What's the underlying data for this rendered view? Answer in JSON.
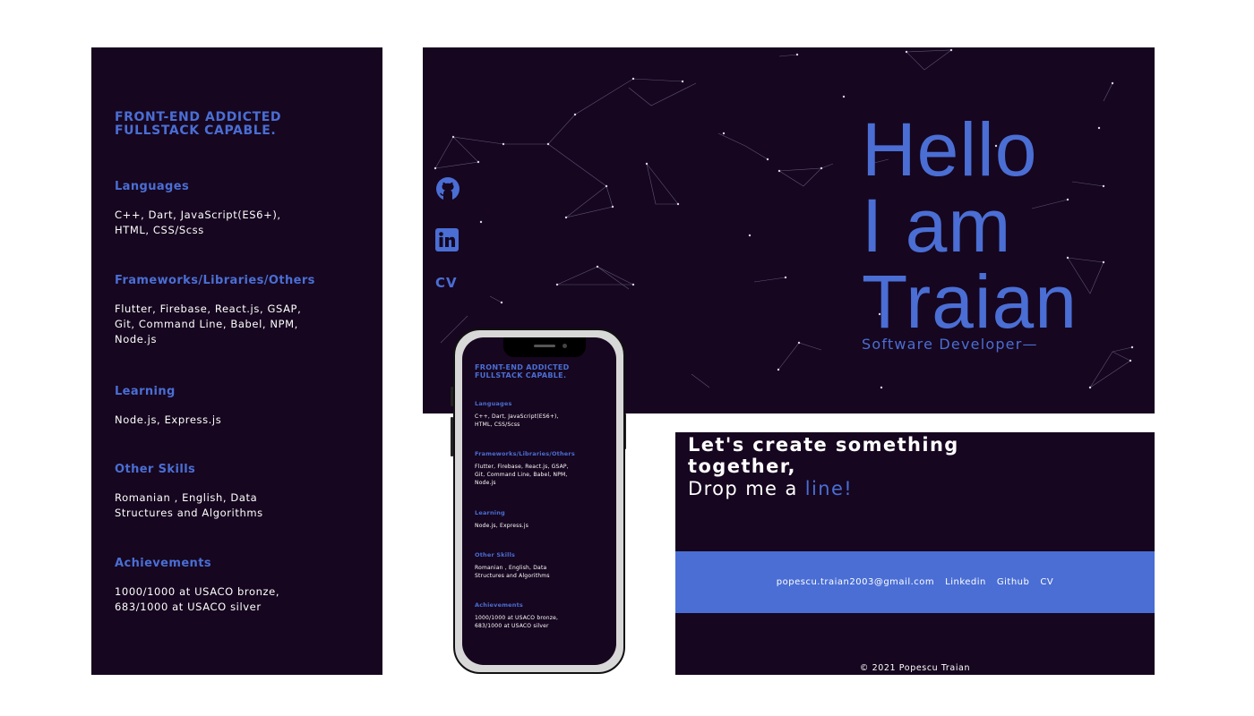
{
  "skills": {
    "tagline": [
      "FRONT-END ADDICTED",
      "FULLSTACK CAPABLE."
    ],
    "sections": [
      {
        "title": "Languages",
        "body": [
          "C++, Dart, JavaScript(ES6+),",
          "HTML, CSS/Scss"
        ]
      },
      {
        "title": "Frameworks/Libraries/Others",
        "body": [
          "Flutter, Firebase, React.js, GSAP,",
          "Git, Command Line, Babel, NPM,",
          "Node.js"
        ]
      },
      {
        "title": "Learning",
        "body": [
          "Node.js, Express.js"
        ]
      },
      {
        "title": "Other Skills",
        "body": [
          "Romanian , English, Data",
          "Structures and Algorithms"
        ]
      },
      {
        "title": "Achievements",
        "body": [
          "1000/1000 at USACO bronze,",
          "683/1000 at USACO silver"
        ]
      }
    ]
  },
  "hero": {
    "line1": "Hello",
    "line2": "I am",
    "line3": "Traian",
    "subtitle": "Software Developer—",
    "cv_label": "CV",
    "icons": [
      "github-icon",
      "linkedin-icon"
    ]
  },
  "contact": {
    "lead1": "Let's create something",
    "lead2": "together,",
    "drop_prefix": "Drop me a ",
    "drop_highlight": "line!",
    "links": [
      "popescu.traian2003@gmail.com",
      "Linkedin",
      "Github",
      "CV"
    ],
    "copyright": "© 2021 Popescu Traian"
  },
  "colors": {
    "background": "#16061f",
    "accent": "#4a6ed4",
    "text": "#ffffff"
  }
}
